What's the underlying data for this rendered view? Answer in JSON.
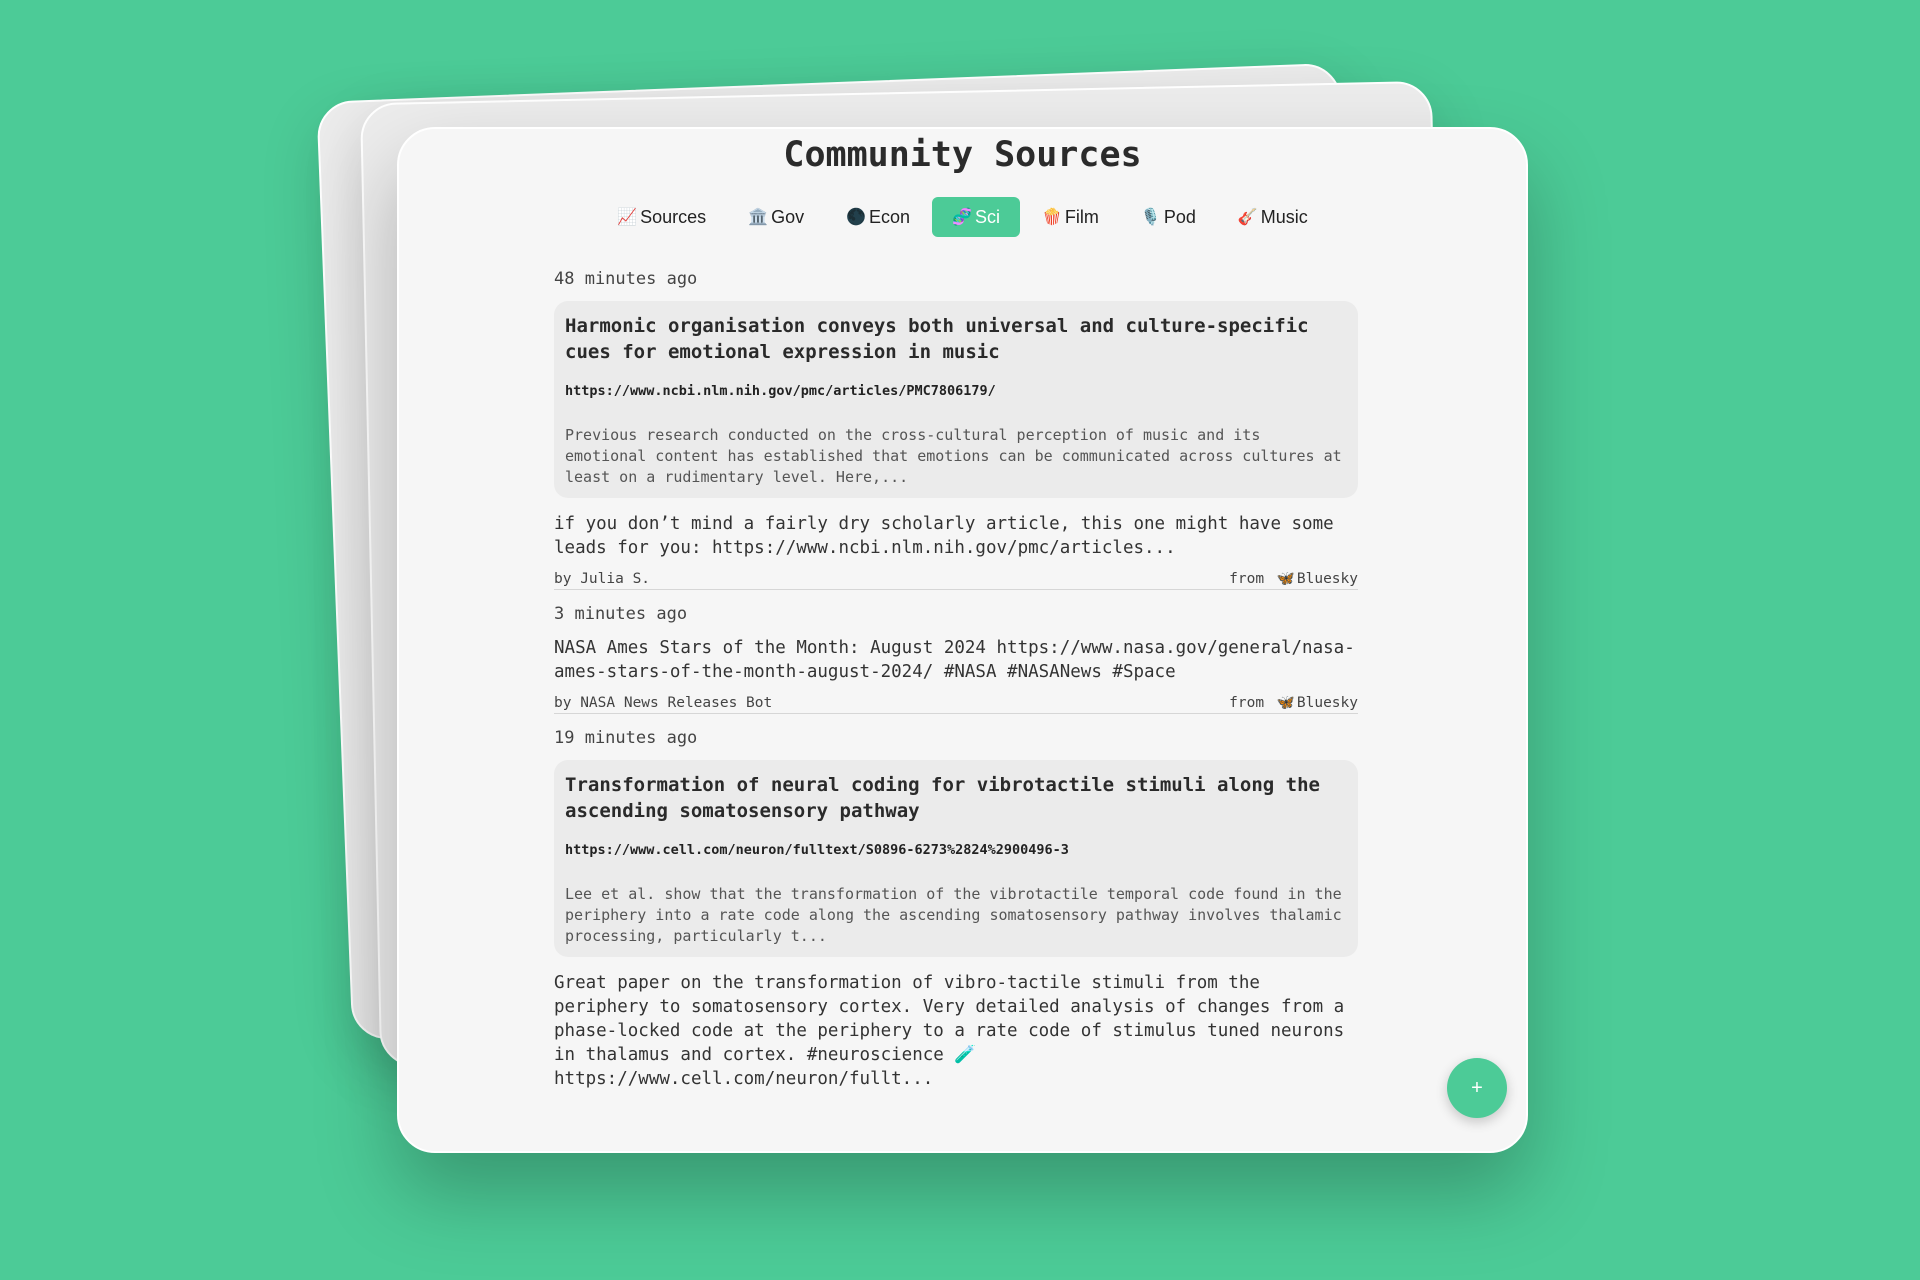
{
  "app": {
    "title": "Community Sources"
  },
  "tabs": [
    {
      "icon": "📈",
      "label": "Sources",
      "active": false
    },
    {
      "icon": "🏛️",
      "label": "Gov",
      "active": false
    },
    {
      "icon": "🌑",
      "label": "Econ",
      "active": false
    },
    {
      "icon": "🧬",
      "label": "Sci",
      "active": true
    },
    {
      "icon": "🍿",
      "label": "Film",
      "active": false
    },
    {
      "icon": "🎙️",
      "label": "Pod",
      "active": false
    },
    {
      "icon": "🎸",
      "label": "Music",
      "active": false
    }
  ],
  "posts": [
    {
      "time": "48 minutes ago",
      "link": {
        "title": "Harmonic organisation conveys both universal and culture-specific cues for emotional expression in music",
        "url": "https://www.ncbi.nlm.nih.gov/pmc/articles/PMC7806179/",
        "desc": "Previous research conducted on the cross-cultural perception of music and its emotional content has established that emotions can be communicated across cultures at least on a rudimentary level. Here,..."
      },
      "text": "if you don’t mind a fairly dry scholarly article, this one might have some leads for you: https://www.ncbi.nlm.nih.gov/pmc/articles...",
      "author": "by Julia S.",
      "from": "from",
      "source_icon": "🦋",
      "source": "Bluesky"
    },
    {
      "time": "3 minutes ago",
      "text": "NASA Ames Stars of the Month: August 2024 https://www.nasa.gov/general/nasa-ames-stars-of-the-month-august-2024/ #NASA #NASANews #Space",
      "author": "by NASA News Releases Bot",
      "from": "from",
      "source_icon": "🦋",
      "source": "Bluesky"
    },
    {
      "time": "19 minutes ago",
      "link": {
        "title": "Transformation of neural coding for vibrotactile stimuli along the ascending somatosensory pathway",
        "url": "https://www.cell.com/neuron/fulltext/S0896-6273%2824%2900496-3",
        "desc": "Lee et al. show that the transformation of the vibrotactile temporal code found in the periphery into a rate code along the ascending somatosensory pathway involves thalamic processing, particularly t..."
      },
      "text": "Great paper on the transformation of vibro-tactile stimuli from the periphery to somatosensory cortex. Very detailed analysis of changes from a phase-locked code at the periphery to a rate code of stimulus tuned neurons in thalamus and cortex. #neuroscience 🧪 https://www.cell.com/neuron/fullt..."
    }
  ],
  "fab": {
    "label": "+"
  },
  "colors": {
    "accent": "#4ccb97",
    "card": "#f6f6f6",
    "link_card": "#ebebeb"
  }
}
